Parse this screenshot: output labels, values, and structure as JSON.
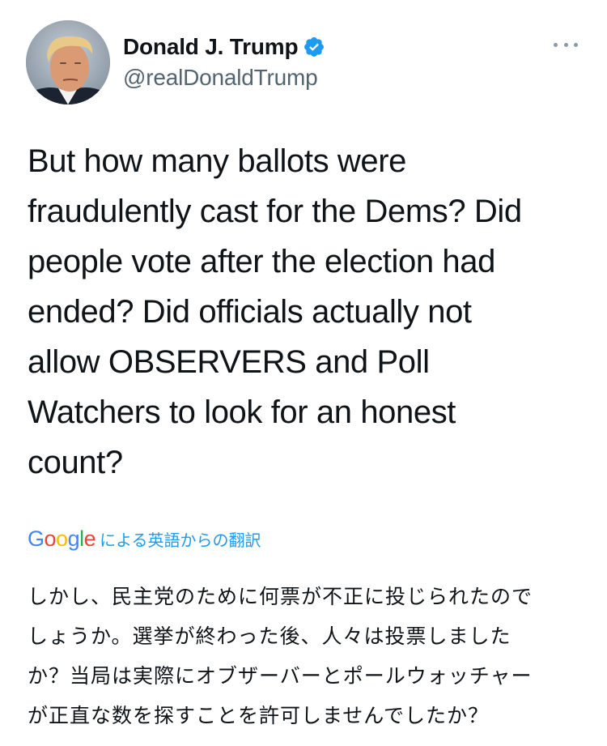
{
  "author": {
    "display_name": "Donald J. Trump",
    "handle": "@realDonaldTrump",
    "verified": true,
    "avatar_icon": "profile-photo"
  },
  "tweet": {
    "text_lines": [
      "But how many ballots were",
      "fraudulently cast for the Dems? Did",
      "people vote after the election had",
      "ended? Did officials actually not",
      "allow OBSERVERS and Poll",
      "Watchers to look for an honest",
      "count?"
    ]
  },
  "translation": {
    "provider_logo": "Google",
    "label": "による英語からの翻訳",
    "text_lines": [
      "しかし、民主党のために何票が不正に投じられたので",
      "しょうか。選挙が終わった後、人々は投票しました",
      "か？当局は実際にオブザーバーとポールウォッチャー",
      "が正直な数を探すことを許可しませんでしたか？"
    ]
  },
  "colors": {
    "link_blue": "#1d9bf0",
    "verified_blue": "#1d9bf0",
    "text_primary": "#0f1419",
    "text_secondary": "#536471"
  },
  "icons": {
    "verified": "verified-badge-icon",
    "more": "more-options-icon"
  }
}
